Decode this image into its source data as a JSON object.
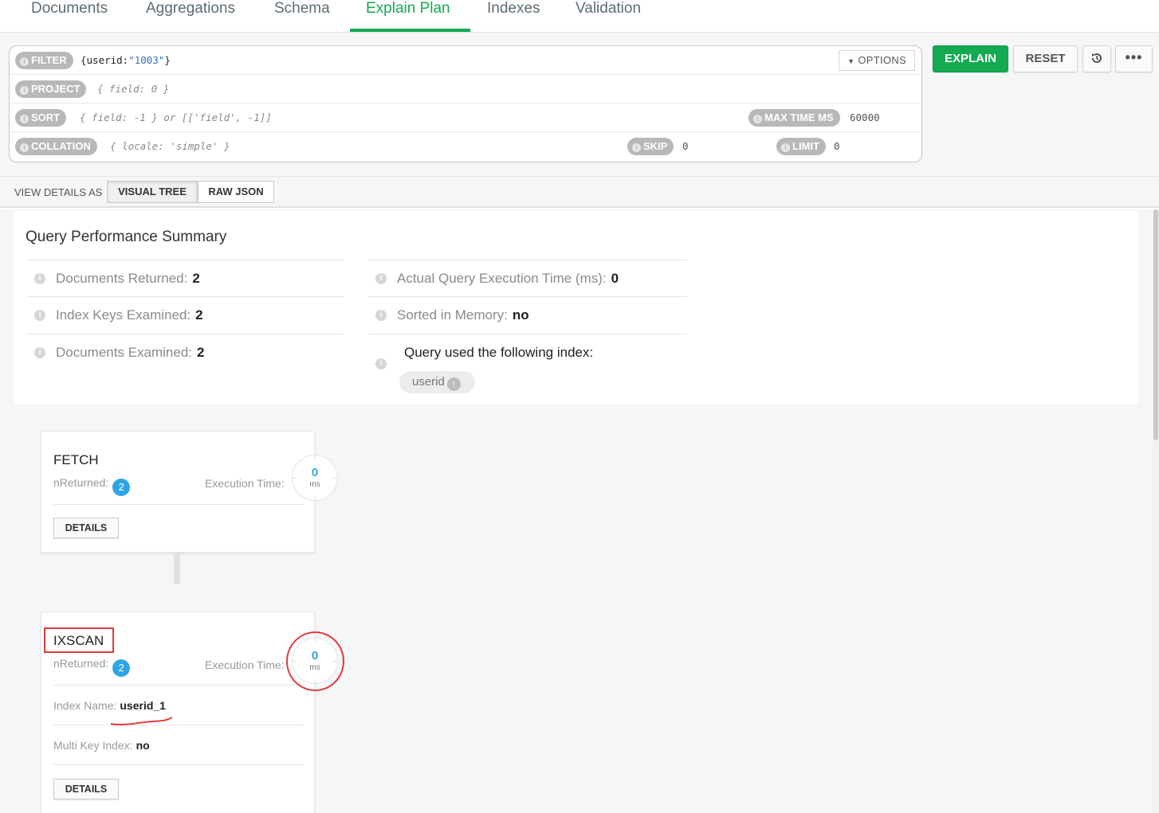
{
  "tabs": [
    {
      "label": "Documents",
      "active": false
    },
    {
      "label": "Aggregations",
      "active": false
    },
    {
      "label": "Schema",
      "active": false
    },
    {
      "label": "Explain Plan",
      "active": true
    },
    {
      "label": "Indexes",
      "active": false
    },
    {
      "label": "Validation",
      "active": false
    }
  ],
  "query_bar": {
    "filter": {
      "label": "FILTER",
      "value_prefix": "{userid:",
      "value_string": "\"1003\"",
      "value_suffix": "}"
    },
    "project": {
      "label": "PROJECT",
      "placeholder": "{ field: 0 }"
    },
    "sort": {
      "label": "SORT",
      "placeholder": "{ field: -1 } or [['field', -1]]"
    },
    "max_time_ms": {
      "label": "MAX TIME MS",
      "value": "60000"
    },
    "collation": {
      "label": "COLLATION",
      "placeholder": "{ locale: 'simple' }"
    },
    "skip": {
      "label": "SKIP",
      "value": "0"
    },
    "limit": {
      "label": "LIMIT",
      "value": "0"
    },
    "options_label": "OPTIONS"
  },
  "actions": {
    "explain": "EXPLAIN",
    "reset": "RESET",
    "history_icon": "history-icon",
    "more_icon": "more-icon"
  },
  "view_details": {
    "label": "VIEW DETAILS AS",
    "visual_tree": "VISUAL TREE",
    "raw_json": "RAW JSON",
    "selected": "VISUAL TREE"
  },
  "summary": {
    "title": "Query Performance Summary",
    "documents_returned": {
      "label": "Documents Returned:",
      "value": "2"
    },
    "index_keys_examined": {
      "label": "Index Keys Examined:",
      "value": "2"
    },
    "documents_examined": {
      "label": "Documents Examined:",
      "value": "2"
    },
    "execution_time": {
      "label": "Actual Query Execution Time (ms):",
      "value": "0"
    },
    "sorted_in_memory": {
      "label": "Sorted in Memory:",
      "value": "no"
    },
    "index_used": {
      "label": "Query used the following index:",
      "index": "userid"
    }
  },
  "stages": {
    "fetch": {
      "title": "FETCH",
      "nreturned_label": "nReturned:",
      "nreturned": "2",
      "exec_label": "Execution Time:",
      "exec_value": "0",
      "exec_unit": "ms",
      "details": "DETAILS"
    },
    "ixscan": {
      "title": "IXSCAN",
      "nreturned_label": "nReturned:",
      "nreturned": "2",
      "exec_label": "Execution Time:",
      "exec_value": "0",
      "exec_unit": "ms",
      "index_name_label": "Index Name:",
      "index_name": "userid_1",
      "multikey_label": "Multi Key Index:",
      "multikey": "no",
      "details": "DETAILS"
    }
  },
  "colors": {
    "accent_green": "#13aa52",
    "badge_blue": "#2fa3e6",
    "annotation_red": "#e23a3a"
  }
}
